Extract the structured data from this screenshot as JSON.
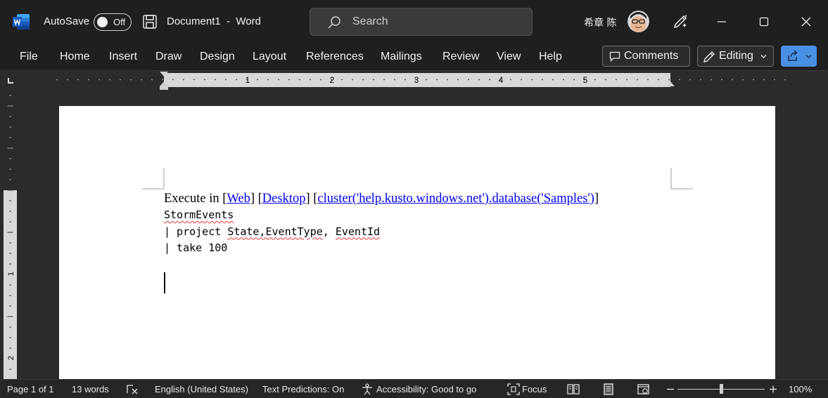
{
  "app": {
    "autosave_label": "AutoSave",
    "autosave_state": "Off",
    "document_title": "Document1  -  Word",
    "search_placeholder": "Search",
    "user_name": "希章 陈"
  },
  "ribbon": {
    "tabs": [
      "File",
      "Home",
      "Insert",
      "Draw",
      "Design",
      "Layout",
      "References",
      "Mailings",
      "Review",
      "View",
      "Help"
    ],
    "comments_label": "Comments",
    "editing_label": "Editing"
  },
  "ruler": {
    "horizontal_numbers": [
      "1",
      "2",
      "3",
      "4",
      "5"
    ],
    "vertical_numbers": [
      "1",
      "2"
    ]
  },
  "document": {
    "line1_prefix": "Execute in [",
    "link_web": "Web",
    "sep1": "] [",
    "link_desktop": "Desktop",
    "sep2": "] [",
    "link_cluster": "cluster('help.kusto.windows.net').database('Samples')",
    "line1_suffix": "]",
    "code_line1": "StormEvents",
    "code_line2_a": "| project ",
    "code_line2_b": "State,EventType",
    "code_line2_c": ", ",
    "code_line2_d": "EventId",
    "code_line3": "| take 100"
  },
  "status": {
    "page": "Page 1 of 1",
    "words": "13 words",
    "language": "English (United States)",
    "text_predictions": "Text Predictions: On",
    "accessibility": "Accessibility: Good to go",
    "focus": "Focus",
    "zoom": "100%"
  },
  "colors": {
    "chrome": "#1f1f1f",
    "canvas": "#2b2b2b",
    "share_button": "#4a90e2",
    "link": "#0000ee",
    "spell_squiggle": "#e53935"
  }
}
